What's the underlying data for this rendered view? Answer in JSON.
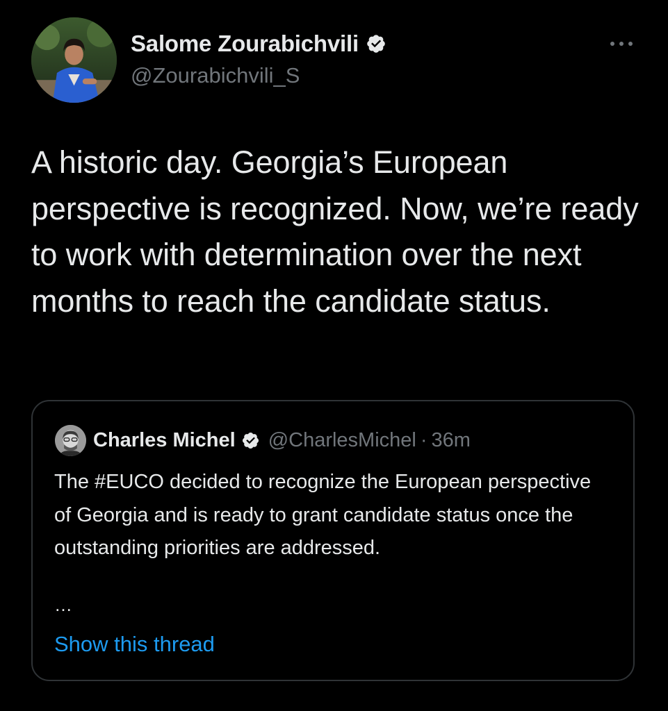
{
  "tweet": {
    "author": {
      "display_name": "Salome Zourabichvili",
      "handle": "@Zourabichvili_S",
      "verified_icon": "verified-badge-icon"
    },
    "more_icon": "more-options-icon",
    "text": "A historic day. Georgia’s European perspective is recognized. Now, we’re ready to work with determination over the next months to reach the candidate status."
  },
  "quoted_tweet": {
    "author": {
      "display_name": "Charles Michel",
      "handle": "@CharlesMichel",
      "verified_icon": "verified-badge-icon"
    },
    "separator": "·",
    "time": "36m",
    "text": "The #EUCO decided to recognize the European perspective of Georgia and is ready to grant candidate status once the outstanding priorities are addressed.",
    "ellipsis": "…",
    "show_thread_label": "Show this thread"
  },
  "colors": {
    "background": "#000000",
    "primary_text": "#e7e9ea",
    "secondary_text": "#71767b",
    "link": "#1d9bf0",
    "border": "#2f3336"
  }
}
